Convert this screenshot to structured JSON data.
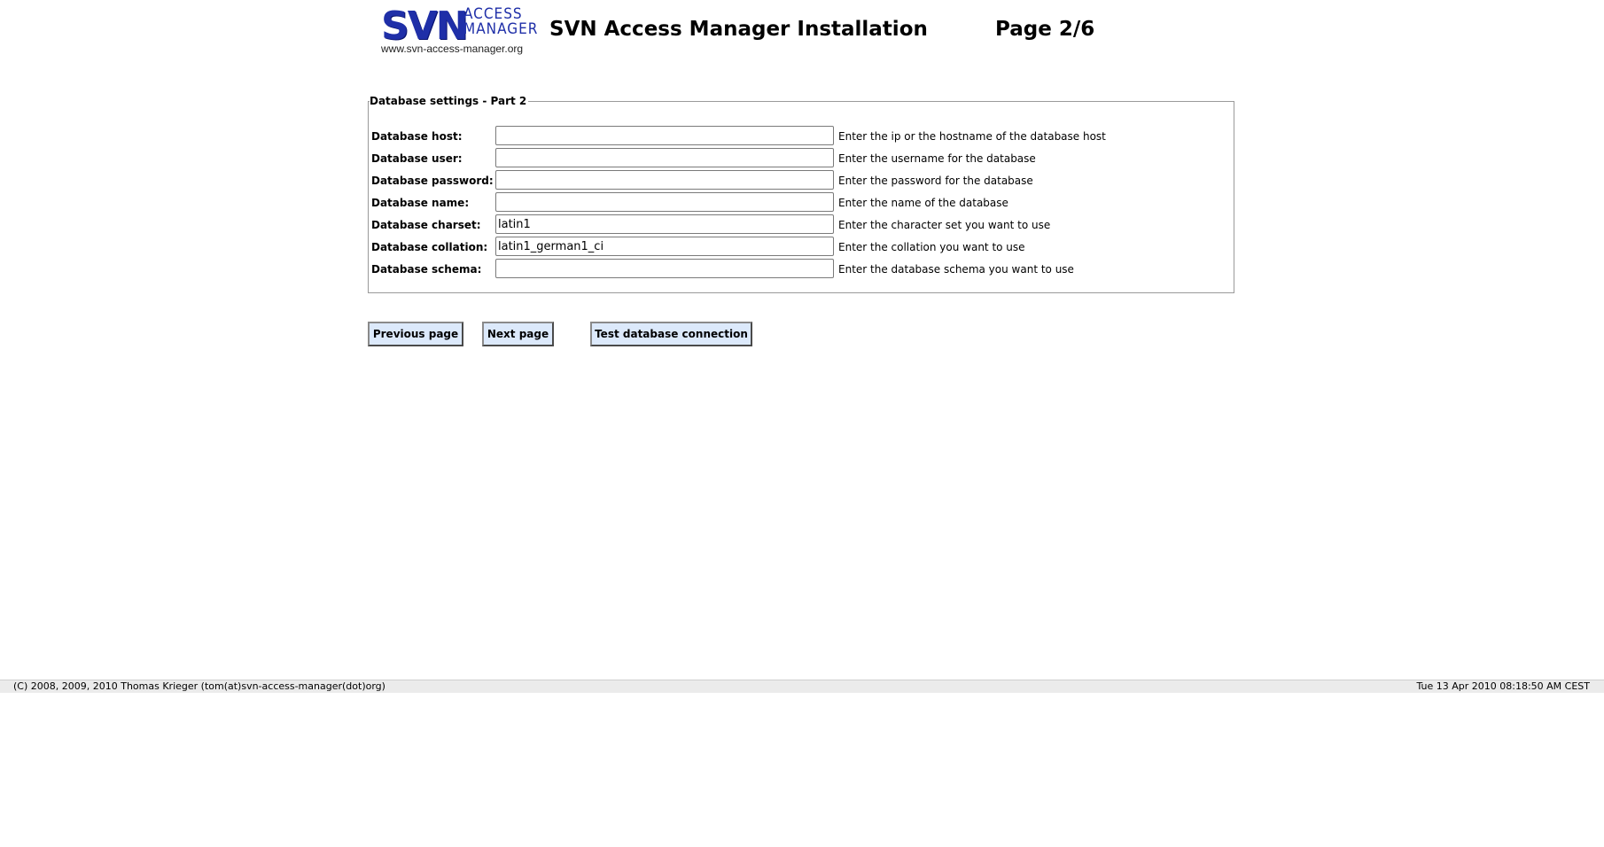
{
  "header": {
    "logo": {
      "main_text": "SVN",
      "sub_text_line1": "ACCESS",
      "sub_text_line2": "MANAGER",
      "url": "www.svn-access-manager.org",
      "color": "#1f2fa8"
    },
    "title": "SVN Access Manager Installation",
    "page_indicator": "Page 2/6"
  },
  "form": {
    "legend": "Database settings - Part 2",
    "fields": [
      {
        "label": "Database host:",
        "value": "",
        "help": "Enter the ip or the hostname of the database host"
      },
      {
        "label": "Database user:",
        "value": "",
        "help": "Enter the username for the database"
      },
      {
        "label": "Database password:",
        "value": "",
        "help": "Enter the password for the database"
      },
      {
        "label": "Database name:",
        "value": "",
        "help": "Enter the name of the database"
      },
      {
        "label": "Database charset:",
        "value": "latin1",
        "help": "Enter the character set you want to use"
      },
      {
        "label": "Database collation:",
        "value": "latin1_german1_ci",
        "help": "Enter the collation you want to use"
      },
      {
        "label": "Database schema:",
        "value": "",
        "help": "Enter the database schema you want to use"
      }
    ]
  },
  "buttons": {
    "previous": "Previous page",
    "next": "Next page",
    "test_connection": "Test database connection",
    "background_color": "#dce9fb"
  },
  "footer": {
    "copyright": "(C) 2008, 2009, 2010 Thomas Krieger (tom(at)svn-access-manager(dot)org)",
    "timestamp": "Tue 13 Apr 2010 08:18:50 AM CEST"
  }
}
